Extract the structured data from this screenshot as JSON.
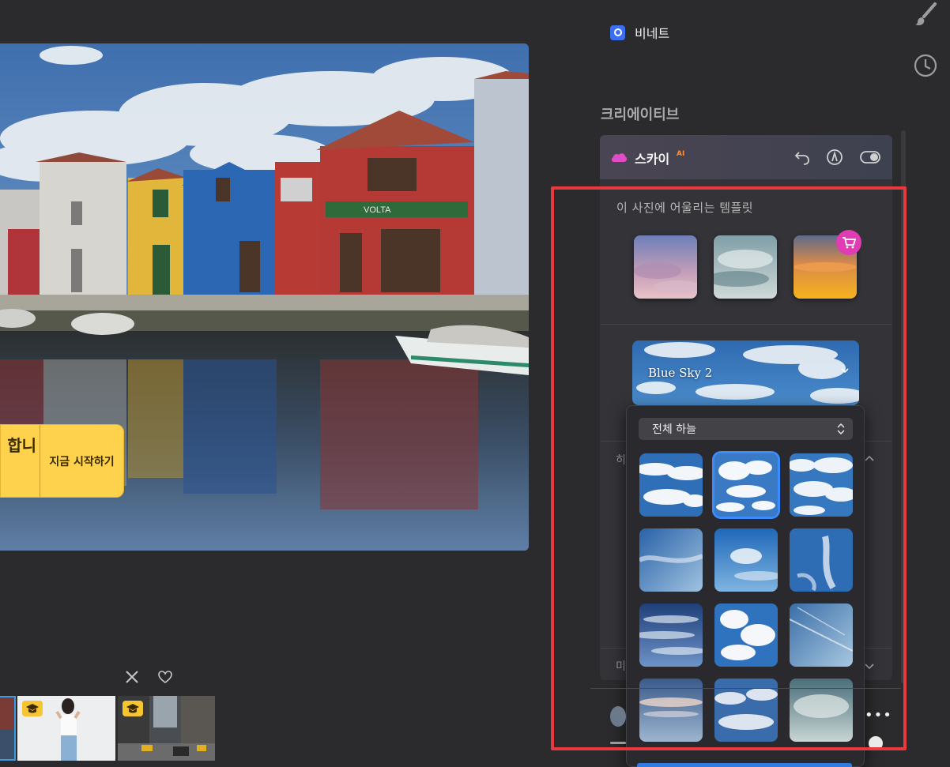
{
  "photo": {
    "sign_text": "VOLTA"
  },
  "promo": {
    "partial_text": "합니",
    "cta_label": "지금 시작하기"
  },
  "filmstrip": {
    "close_icon": "x-icon",
    "favorite_icon": "heart-icon",
    "thumbnails": [
      {
        "name": "town-thumb",
        "badge": false
      },
      {
        "name": "woman-portrait-thumb",
        "badge": true
      },
      {
        "name": "city-street-thumb",
        "badge": true
      }
    ]
  },
  "right_toolbar": {
    "brush_icon": "brush-icon",
    "history_icon": "clock-icon"
  },
  "vignette": {
    "label": "비네트",
    "checked": true
  },
  "creative": {
    "section_title": "크리에이티브"
  },
  "sky_tool": {
    "title": "스카이",
    "ai_badge": "AI",
    "icons": [
      "undo-icon",
      "brush-mask-icon",
      "toggle-switch"
    ],
    "template_label": "이 사진에 어울리는 템플릿",
    "templates": [
      "pastel-sky",
      "cloudy-sky",
      "sunset-sky"
    ],
    "premium_badge": "cart-icon",
    "selected_sky": "Blue Sky 2",
    "hidden_row_1": "히",
    "hidden_row_2": "미"
  },
  "sky_dropdown": {
    "category": "전체 하늘",
    "selected_index": 1,
    "items": 12
  },
  "colors": {
    "accent": "#3a8cff",
    "highlight": "#e8393f",
    "promo": "#ffd24d",
    "premium": "#e23cb4"
  }
}
